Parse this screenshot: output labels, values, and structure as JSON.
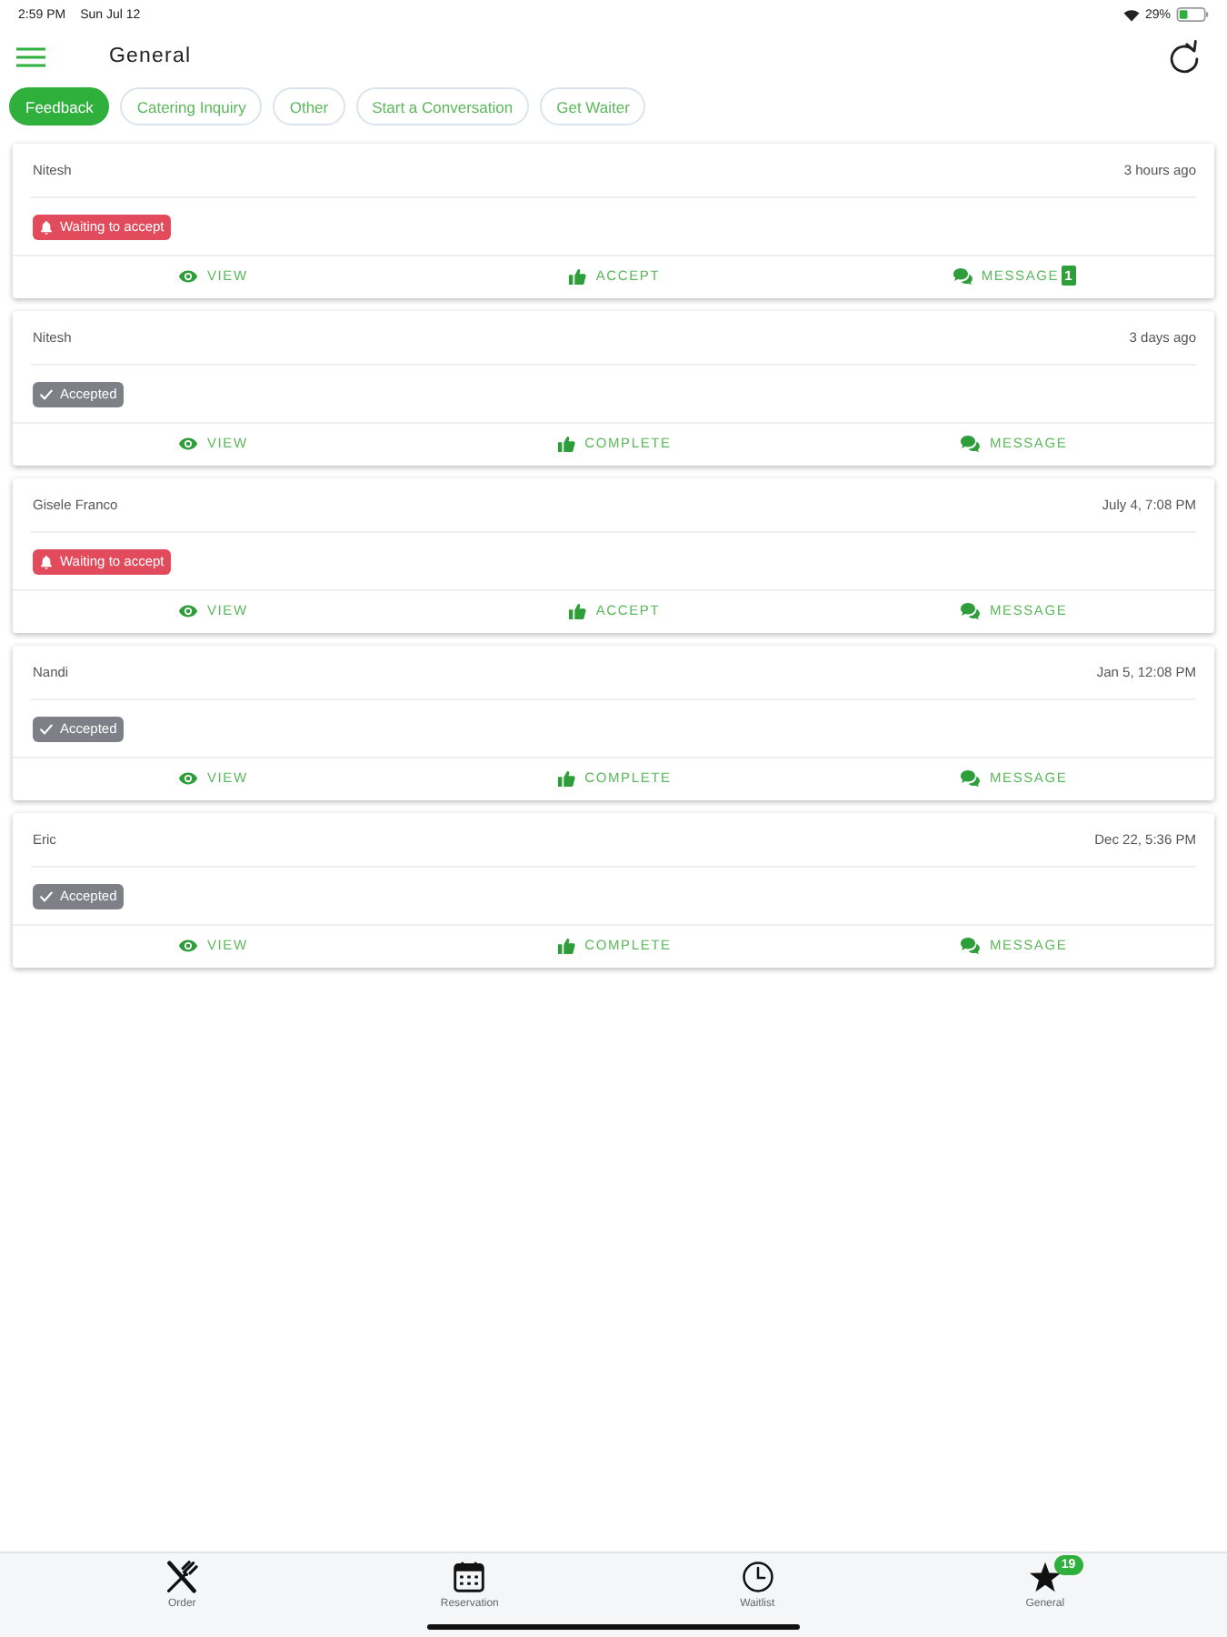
{
  "status_bar": {
    "time": "2:59 PM",
    "date": "Sun Jul 12",
    "battery": "29%"
  },
  "header": {
    "title": "General"
  },
  "filters": [
    {
      "label": "Feedback",
      "selected": true
    },
    {
      "label": "Catering Inquiry",
      "selected": false
    },
    {
      "label": "Other",
      "selected": false
    },
    {
      "label": "Start a Conversation",
      "selected": false
    },
    {
      "label": "Get Waiter",
      "selected": false
    }
  ],
  "cards": [
    {
      "name": "Nitesh",
      "time": "3 hours ago",
      "status": {
        "kind": "waiting",
        "label": "Waiting to accept"
      },
      "actions": [
        {
          "kind": "view",
          "label": "VIEW"
        },
        {
          "kind": "accept",
          "label": "ACCEPT"
        },
        {
          "kind": "message",
          "label": "MESSAGE",
          "badge": "1"
        }
      ]
    },
    {
      "name": "Nitesh",
      "time": "3 days ago",
      "status": {
        "kind": "accepted",
        "label": "Accepted"
      },
      "actions": [
        {
          "kind": "view",
          "label": "VIEW"
        },
        {
          "kind": "complete",
          "label": "COMPLETE"
        },
        {
          "kind": "message",
          "label": "MESSAGE"
        }
      ]
    },
    {
      "name": "Gisele Franco",
      "time": "July 4, 7:08 PM",
      "status": {
        "kind": "waiting",
        "label": "Waiting to accept"
      },
      "actions": [
        {
          "kind": "view",
          "label": "VIEW"
        },
        {
          "kind": "accept",
          "label": "ACCEPT"
        },
        {
          "kind": "message",
          "label": "MESSAGE"
        }
      ]
    },
    {
      "name": "Nandi",
      "time": "Jan 5, 12:08 PM",
      "status": {
        "kind": "accepted",
        "label": "Accepted"
      },
      "actions": [
        {
          "kind": "view",
          "label": "VIEW"
        },
        {
          "kind": "complete",
          "label": "COMPLETE"
        },
        {
          "kind": "message",
          "label": "MESSAGE"
        }
      ]
    },
    {
      "name": "Eric",
      "time": "Dec 22, 5:36 PM",
      "status": {
        "kind": "accepted",
        "label": "Accepted"
      },
      "actions": [
        {
          "kind": "view",
          "label": "VIEW"
        },
        {
          "kind": "complete",
          "label": "COMPLETE"
        },
        {
          "kind": "message",
          "label": "MESSAGE"
        }
      ]
    }
  ],
  "tab_bar": [
    {
      "kind": "order",
      "label": "Order"
    },
    {
      "kind": "reservation",
      "label": "Reservation"
    },
    {
      "kind": "waitlist",
      "label": "Waitlist"
    },
    {
      "kind": "general",
      "label": "General",
      "badge": "19"
    }
  ]
}
